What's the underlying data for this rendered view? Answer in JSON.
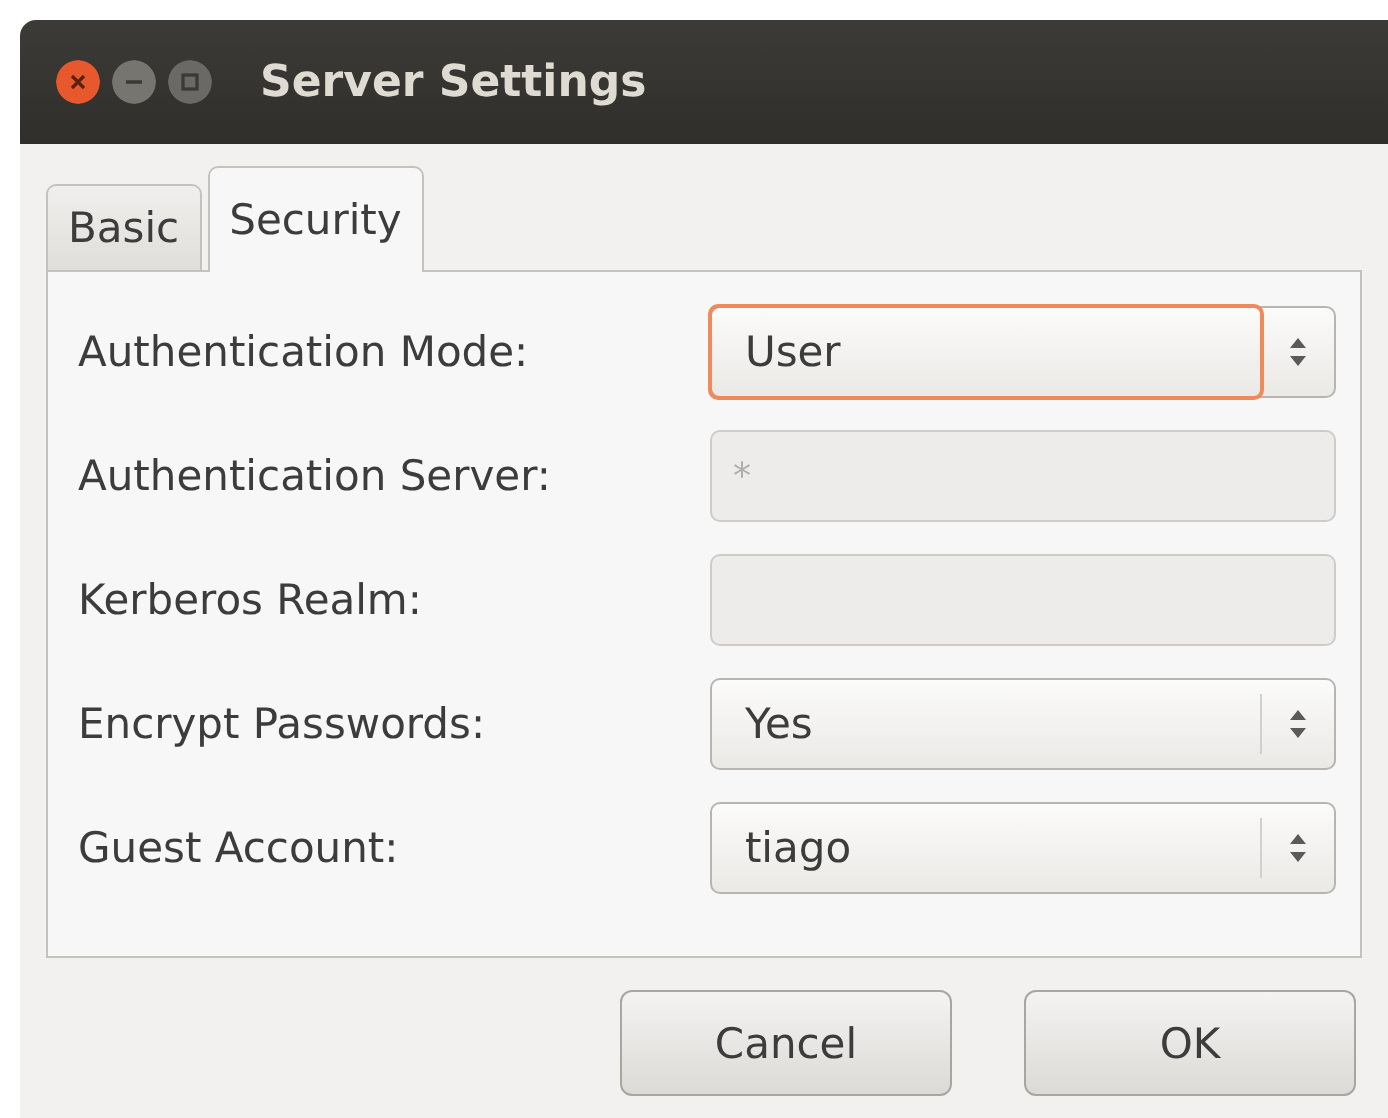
{
  "window": {
    "title": "Server Settings"
  },
  "tabs": [
    {
      "label": "Basic",
      "selected": false
    },
    {
      "label": "Security",
      "selected": true
    }
  ],
  "fields": [
    {
      "label": "Authentication Mode:",
      "kind": "combo",
      "value": "User",
      "focused": true,
      "disabled": false
    },
    {
      "label": "Authentication Server:",
      "kind": "entry",
      "value": "*",
      "focused": false,
      "disabled": true
    },
    {
      "label": "Kerberos Realm:",
      "kind": "entry",
      "focused": false,
      "disabled": true
    },
    {
      "label": "Encrypt Passwords:",
      "kind": "combo",
      "value": "Yes",
      "focused": false,
      "disabled": false
    },
    {
      "label": "Guest Account:",
      "kind": "combo",
      "value": "tiago",
      "focused": false,
      "disabled": false
    }
  ],
  "buttons": [
    "Cancel",
    "OK"
  ]
}
